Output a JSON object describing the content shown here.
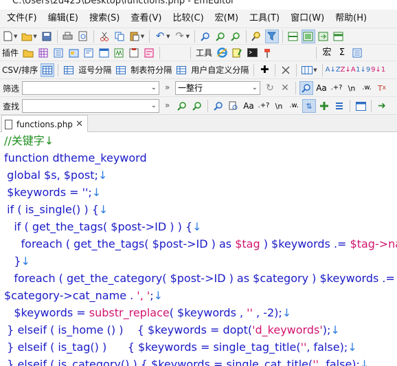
{
  "window": {
    "title": "C:\\Users\\2d425\\Desktop\\functions.php - EmEditor"
  },
  "menu": [
    "文件(F)",
    "编辑(E)",
    "搜索(S)",
    "查看(V)",
    "比较(C)",
    "宏(M)",
    "工具(T)",
    "窗口(W)",
    "帮助(H)"
  ],
  "toolbar2": {
    "plugins_label": "插件",
    "tools_label": "工具"
  },
  "toolbar3": {
    "csv_label": "CSV/排序",
    "comma_label": "逗号分隔",
    "tab_label": "制表符分隔",
    "user_label": "用户自定义分隔"
  },
  "filter": {
    "label": "筛选",
    "value": "",
    "mode": "一整行"
  },
  "find": {
    "label": "查找",
    "value": ""
  },
  "tabs": [
    {
      "name": "functions.php"
    }
  ],
  "code": {
    "l1": "//关键字↓",
    "l2a": "function",
    "l2b": " dtheme_keyword",
    "l3": "  global $s, $post;",
    "l4": "  $keywords = '';",
    "l5": "  if ( is_single() ) {",
    "l6": "    if ( get_the_tags( $post->ID ) ) {",
    "l7a": "      foreach ( get_the_tags( $post->ID ) as ",
    "l7b": "$tag",
    "l7c": " ) $keywords .= ",
    "l7d": "$tag->name",
    "l8": "    }",
    "l9": "    foreach ( get_the_category( $post->ID ) as $category ) $keywords .=",
    "l10a": "$category->cat_name . ",
    "l10b": "', '",
    "l11a": "    $keywords = ",
    "l11b": "substr_replace",
    "l11c": "( $keywords , ",
    "l11d": "''",
    "l11e": " , -2);",
    "l12a": "  } elseif ( is_home () )    { $keywords = dopt(",
    "l12b": "'d_keywords'",
    "l12c": ");",
    "l13a": "  } elseif ( is_tag() )      { $keywords = single_tag_title(",
    "l13b": "''",
    "l13c": ", false);",
    "l14a": "  } elseif ( is_category() ) { $keywords = single_cat_title(",
    "l14b": "''",
    "l14c": ", false);"
  },
  "colors": {
    "keyword": "#1a1ac8",
    "string": "#d2146e",
    "comment": "#1f8f1f",
    "newline_mark": "#2b7be0"
  }
}
